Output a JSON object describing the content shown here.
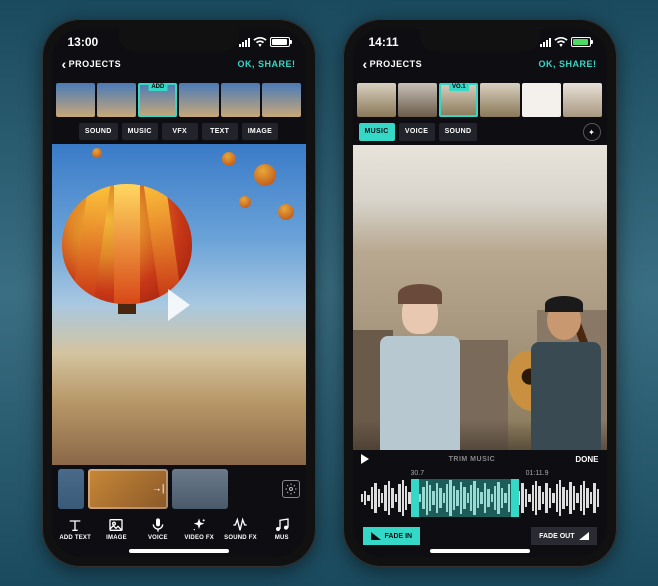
{
  "phone1": {
    "time": "13:00",
    "back": "PROJECTS",
    "share": "OK, SHARE!",
    "tag": "ADD",
    "tracks": [
      "SOUND",
      "MUSIC",
      "VFX",
      "TEXT",
      "IMAGE"
    ],
    "bottom": [
      "ADD TEXT",
      "IMAGE",
      "VOICE",
      "VIDEO FX",
      "SOUND FX",
      "MUS"
    ]
  },
  "phone2": {
    "time": "14:11",
    "back": "PROJECTS",
    "share": "OK, SHARE!",
    "tag": "VO.1",
    "tracks": [
      "MUSIC",
      "VOICE",
      "SOUND"
    ],
    "trim_title": "TRIM MUSIC",
    "done": "DONE",
    "t_start": "30.7",
    "t_end": "01:11.9",
    "fade_in": "FADE IN",
    "fade_out": "FADE OUT"
  }
}
